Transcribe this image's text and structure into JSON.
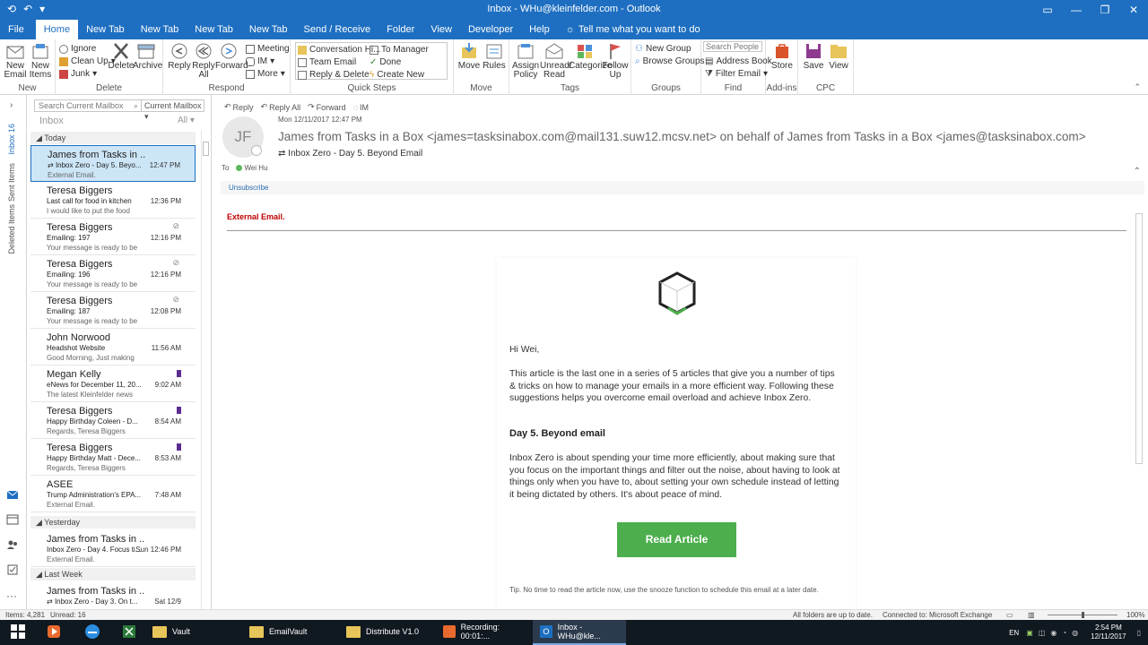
{
  "window": {
    "title": "Inbox - WHu@kleinfelder.com  -  Outlook"
  },
  "tabs": [
    "File",
    "Home",
    "New Tab",
    "New Tab",
    "New Tab",
    "New Tab",
    "Send / Receive",
    "Folder",
    "View",
    "Developer",
    "Help"
  ],
  "tell_me": "Tell me what you want to do",
  "ribbon": {
    "new_email": "New Email",
    "new_items": "New Items",
    "group_new": "New",
    "ignore": "Ignore",
    "clean_up": "Clean Up",
    "junk": "Junk",
    "delete": "Delete",
    "archive": "Archive",
    "group_delete": "Delete",
    "reply": "Reply",
    "reply_all": "Reply All",
    "forward": "Forward",
    "meeting": "Meeting",
    "im": "IM",
    "more": "More",
    "group_respond": "Respond",
    "qs_items": [
      "Conversation Hi...",
      "Team Email",
      "Reply & Delete",
      "To Manager",
      "Done",
      "Create New"
    ],
    "group_quicksteps": "Quick Steps",
    "move": "Move",
    "rules": "Rules",
    "group_move": "Move",
    "assign_policy": "Assign Policy",
    "unread_read": "Unread/ Read",
    "categorize": "Categorize",
    "follow_up": "Follow Up",
    "group_tags": "Tags",
    "new_group": "New Group",
    "browse_groups": "Browse Groups",
    "group_groups": "Groups",
    "search_people": "Search People",
    "address_book": "Address Book",
    "filter_email": "Filter Email",
    "group_find": "Find",
    "store": "Store",
    "group_addins": "Add-ins",
    "save": "Save",
    "view": "View",
    "group_cpc": "CPC"
  },
  "nav": {
    "inbox": "Inbox 16",
    "sent": "Sent Items",
    "deleted": "Deleted Items"
  },
  "list": {
    "search_placeholder": "Search Current Mailbox",
    "mailbox_scope": "Current Mailbox",
    "folder": "Inbox",
    "filter": "All",
    "groups": [
      "Today",
      "Yesterday",
      "Last Week"
    ],
    "messages": [
      {
        "from": "James from Tasks in ...",
        "subject": "Inbox Zero - Day 5. Beyo...",
        "preview": "External Email.",
        "time": "12:47 PM"
      },
      {
        "from": "Teresa Biggers",
        "subject": "Last call for food in kitchen",
        "preview": "I would like to put the food",
        "time": "12:36 PM"
      },
      {
        "from": "Teresa Biggers",
        "subject": "Emailing: 197",
        "preview": "Your message is ready to be",
        "time": "12:16 PM"
      },
      {
        "from": "Teresa Biggers",
        "subject": "Emailing: 196",
        "preview": "Your message is ready to be",
        "time": "12:16 PM"
      },
      {
        "from": "Teresa Biggers",
        "subject": "Emailing: 187",
        "preview": "Your message is ready to be",
        "time": "12:08 PM"
      },
      {
        "from": "John Norwood",
        "subject": "Headshot Website",
        "preview": "Good Morning,  Just making",
        "time": "11:56 AM"
      },
      {
        "from": "Megan Kelly",
        "subject": "eNews for December 11, 20...",
        "preview": "The latest Kleinfelder news",
        "time": "9:02 AM"
      },
      {
        "from": "Teresa Biggers",
        "subject": "Happy Birthday Coleen - D...",
        "preview": "Regards,  Teresa Biggers",
        "time": "8:54 AM"
      },
      {
        "from": "Teresa Biggers",
        "subject": "Happy Birthday Matt - Dece...",
        "preview": "Regards,  Teresa Biggers",
        "time": "8:53 AM"
      },
      {
        "from": "ASEE",
        "subject": "Trump Administration's EPA...",
        "preview": "External Email.",
        "time": "7:48 AM"
      },
      {
        "from": "James from Tasks in ...",
        "subject": "Inbox Zero - Day 4. Focus ti...",
        "preview": "External Email.",
        "time": "Sun 12:46 PM"
      },
      {
        "from": "James from Tasks in ...",
        "subject": "Inbox Zero - Day 3. On t...",
        "preview": "",
        "time": "Sat 12/9"
      }
    ]
  },
  "reading": {
    "reply": "Reply",
    "reply_all": "Reply All",
    "forward": "Forward",
    "im": "IM",
    "initials": "JF",
    "date": "Mon 12/11/2017 12:47 PM",
    "sender": "James from Tasks in a Box <james=tasksinabox.com@mail131.suw12.mcsv.net> on behalf of James from Tasks in a Box <james@tasksinabox.com>",
    "subject": "Inbox Zero - Day 5. Beyond Email",
    "to_label": "To",
    "to_name": "Wei Hu",
    "unsubscribe": "Unsubscribe",
    "external": "External Email.",
    "greeting": "Hi Wei,",
    "para1": "This article is the last one in a series of 5 articles that give you a number of tips & tricks on how to manage your emails in a more efficient way. Following these suggestions helps you overcome email overload and achieve Inbox Zero.",
    "heading": "Day 5. Beyond email",
    "para2": "Inbox Zero is about spending your time more efficiently, about making sure that you focus on the important things and filter out the noise, about having to look at things only when you have to, about setting your own schedule instead of letting it being dictated by others. It's about peace of mind.",
    "button": "Read Article",
    "tip": "Tip. No time to read the article now, use the snooze function to schedule this email at a later date."
  },
  "status": {
    "items": "Items: 4,281",
    "unread": "Unread: 16",
    "sync": "All folders are up to date.",
    "connection": "Connected to: Microsoft Exchange",
    "zoom": "100%"
  },
  "taskbar": {
    "items": [
      "Vault",
      "EmailVault",
      "Distribute V1.0",
      "Recording: 00:01:...",
      "Inbox - WHu@kle..."
    ],
    "lang": "EN",
    "time": "2:54 PM",
    "date": "12/11/2017"
  },
  "colors": {
    "accent": "#1e6fc1",
    "button": "#4cae4c",
    "external": "#c00000",
    "flag": "#5c2d91"
  }
}
